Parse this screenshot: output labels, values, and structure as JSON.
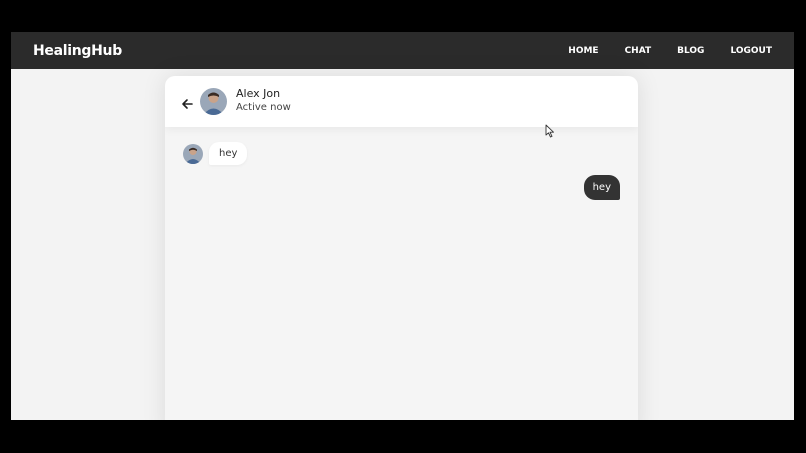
{
  "brand": {
    "name": "HealingHub"
  },
  "nav": {
    "items": [
      {
        "label": "HOME"
      },
      {
        "label": "CHAT"
      },
      {
        "label": "BLOG"
      },
      {
        "label": "LOGOUT"
      }
    ]
  },
  "chat": {
    "header": {
      "back_icon": "arrow-left-icon",
      "contact_name": "Alex Jon",
      "contact_status": "Active now"
    },
    "messages": [
      {
        "direction": "incoming",
        "text": "hey"
      },
      {
        "direction": "outgoing",
        "text": "hey"
      }
    ]
  },
  "colors": {
    "navbar_bg": "#2b2b2b",
    "page_bg": "#f3f3f3",
    "outgoing_bubble": "#333333",
    "incoming_bubble": "#ffffff"
  }
}
